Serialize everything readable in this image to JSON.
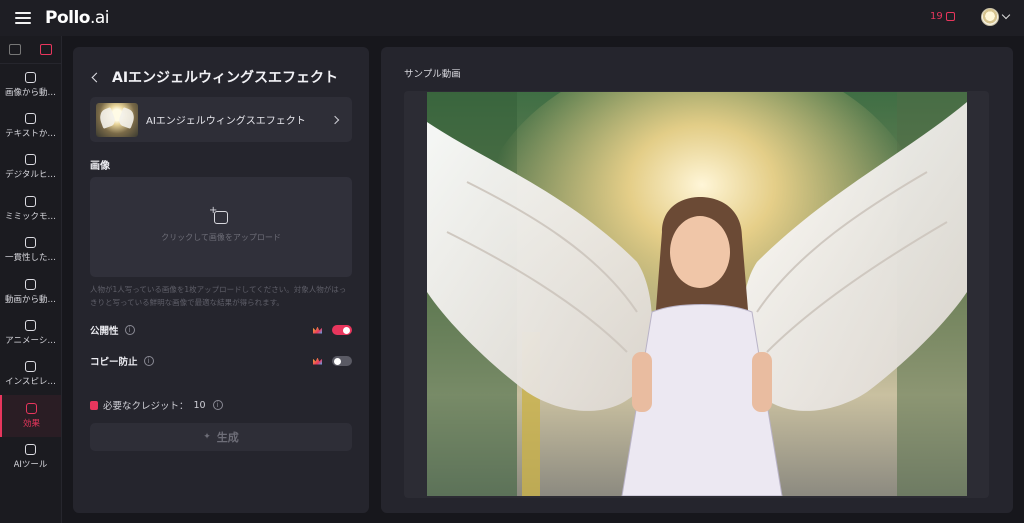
{
  "topbar": {
    "logo_main": "Pollo",
    "logo_suffix": ".ai",
    "credits": "19"
  },
  "sidebar": {
    "items": [
      {
        "label": "画像から動…",
        "icon": "image-to-video-icon"
      },
      {
        "label": "テキストか…",
        "icon": "text-to-video-icon"
      },
      {
        "label": "デジタルヒ…",
        "icon": "digital-human-icon"
      },
      {
        "label": "ミミックモ…",
        "icon": "mimic-motion-icon"
      },
      {
        "label": "一貫性した…",
        "icon": "consistent-video-icon"
      },
      {
        "label": "動画から動…",
        "icon": "video-to-video-icon"
      },
      {
        "label": "アニメーシ…",
        "icon": "animation-icon"
      },
      {
        "label": "インスピレ…",
        "icon": "inspiration-icon"
      },
      {
        "label": "効果",
        "icon": "effects-icon",
        "active": true
      },
      {
        "label": "AIツール",
        "icon": "ai-tools-icon"
      }
    ]
  },
  "panel": {
    "title": "AIエンジェルウィングスエフェクト",
    "effect_name": "AIエンジェルウィングスエフェクト",
    "image_section": "画像",
    "upload_text": "クリックして画像をアップロード",
    "hint": "人物が1人写っている画像を1枚アップロードしてください。対象人物がはっきりと写っている鮮明な画像で最適な結果が得られます。",
    "public_label": "公開性",
    "public_on": true,
    "copy_label": "コピー防止",
    "copy_on": false,
    "credit_label": "必要なクレジット：",
    "credit_value": "10",
    "generate_label": "生成"
  },
  "preview": {
    "title": "サンプル動画"
  },
  "colors": {
    "accent": "#e8365d",
    "panel": "#25252d",
    "background": "#17171c"
  }
}
